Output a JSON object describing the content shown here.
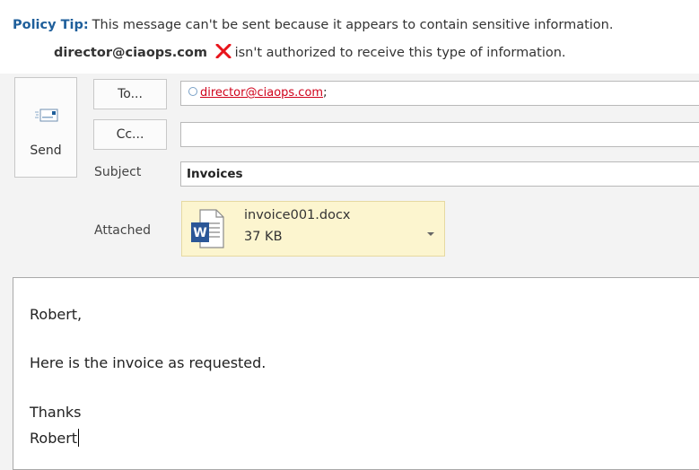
{
  "policy_tip": {
    "title": "Policy Tip:",
    "message": "This message can't be sent because it appears to contain sensitive information.",
    "email": "director@ciaops.com",
    "detail": "isn't authorized to receive this type of information.",
    "icon": "red-x-icon",
    "accent_color": "#1f5f9b",
    "error_color": "#e8141b"
  },
  "compose": {
    "send_label": "Send",
    "to_label": "To...",
    "cc_label": "Cc...",
    "subject_label": "Subject",
    "attached_label": "Attached",
    "to_recipient": "director@ciaops.com",
    "to_separator": ";",
    "cc_value": "",
    "subject_value": "Invoices"
  },
  "attachment": {
    "name": "invoice001.docx",
    "size": "37 KB",
    "icon": "word-document-icon"
  },
  "body": {
    "greeting": "Robert,",
    "line": "Here is the invoice as requested.",
    "closing": "Thanks",
    "signature": "Robert"
  }
}
